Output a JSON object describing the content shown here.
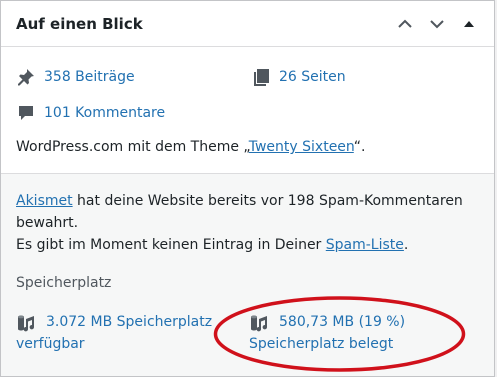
{
  "widget": {
    "title": "Auf einen Blick"
  },
  "glance": {
    "posts": "358 Beiträge",
    "pages": "26 Seiten",
    "comments": "101 Kommentare"
  },
  "theme": {
    "prefix": "WordPress.com mit dem Theme „",
    "name": "Twenty Sixteen",
    "suffix": "“."
  },
  "akismet": {
    "link": "Akismet",
    "line1_rest": " hat deine Website bereits vor 198 Spam-Kommentaren",
    "line2": "bewahrt.",
    "line3_prefix": "Es gibt im Moment keinen Eintrag in Deiner ",
    "spam_link": "Spam-Liste",
    "line3_suffix": "."
  },
  "storage": {
    "title": "Speicherplatz",
    "available_line1": "3.072 MB Speicherplatz",
    "available_line2": "verfügbar",
    "used_line1": "580,73 MB (19 %)",
    "used_line2": "Speicherplatz belegt"
  },
  "colors": {
    "link": "#2271b1",
    "annotation": "#d0111b",
    "icon": "#50575e"
  },
  "icons": [
    "pin-icon",
    "pages-icon",
    "comment-icon",
    "storage-icon",
    "chevron-up-icon",
    "chevron-down-icon"
  ]
}
